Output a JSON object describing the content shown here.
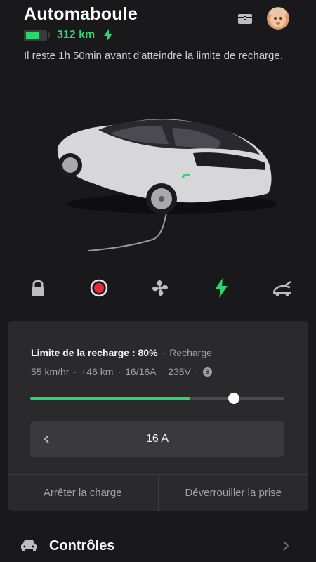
{
  "vehicle": {
    "name": "Automaboule",
    "range": "312 km",
    "battery_level": 0.72,
    "status_message": "Il reste 1h 50min avant d'atteindre la limite de recharge."
  },
  "header": {
    "icons": [
      "chest-icon",
      "avatar"
    ]
  },
  "quick_controls": [
    {
      "name": "lock-icon"
    },
    {
      "name": "record-icon"
    },
    {
      "name": "fan-icon"
    },
    {
      "name": "charging-bolt-icon",
      "active": true
    },
    {
      "name": "trunk-icon"
    }
  ],
  "charging": {
    "limit_label": "Limite de la recharge : 80%",
    "state": "Recharge",
    "rate": "55 km/hr",
    "added": "+46 km",
    "current": "16/16A",
    "voltage": "235V",
    "phases": "3",
    "current_level": 0.63,
    "limit_level": 0.8,
    "amps_value": "16 A",
    "stop_label": "Arrêter la charge",
    "unlock_label": "Déverrouiller la prise"
  },
  "controls": {
    "label": "Contrôles"
  },
  "colors": {
    "accent": "#2bd56f",
    "background": "#19191b",
    "panel": "#2a2a2c",
    "record_red": "#e8283a"
  }
}
